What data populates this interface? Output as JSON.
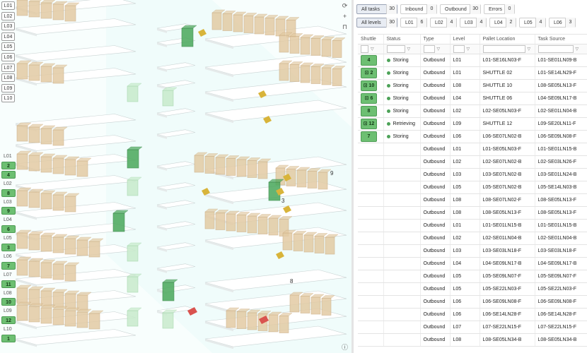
{
  "levels": [
    "L01",
    "L02",
    "L03",
    "L04",
    "L05",
    "L06",
    "L07",
    "L08",
    "L09",
    "L10"
  ],
  "side_list": [
    {
      "kind": "label",
      "text": "L01"
    },
    {
      "kind": "shuttle",
      "text": "2"
    },
    {
      "kind": "shuttle",
      "text": "4"
    },
    {
      "kind": "label",
      "text": "L02"
    },
    {
      "kind": "shuttle",
      "text": "8"
    },
    {
      "kind": "label",
      "text": "L03"
    },
    {
      "kind": "shuttle",
      "text": "9"
    },
    {
      "kind": "label",
      "text": "L04"
    },
    {
      "kind": "shuttle",
      "text": "6"
    },
    {
      "kind": "label",
      "text": "L05"
    },
    {
      "kind": "shuttle",
      "text": "3"
    },
    {
      "kind": "label",
      "text": "L06"
    },
    {
      "kind": "shuttle",
      "text": "7"
    },
    {
      "kind": "label",
      "text": "L07"
    },
    {
      "kind": "shuttle",
      "text": "11"
    },
    {
      "kind": "label",
      "text": "L08"
    },
    {
      "kind": "shuttle",
      "text": "10"
    },
    {
      "kind": "label",
      "text": "L09"
    },
    {
      "kind": "shuttle",
      "text": "12"
    },
    {
      "kind": "label",
      "text": "L10"
    },
    {
      "kind": "shuttle",
      "text": "1"
    }
  ],
  "scene_labels": [
    "9",
    "3",
    "8"
  ],
  "view_tools": [
    "refresh-icon",
    "crosshair-icon",
    "lock-icon"
  ],
  "view_tool_glyphs": {
    "refresh": "⟳",
    "crosshair": "+",
    "lock": "⊓",
    "info": "ⓘ"
  },
  "type_filters": [
    {
      "label": "All tasks",
      "count": "30",
      "active": true
    },
    {
      "label": "Inbound",
      "count": "0",
      "active": false
    },
    {
      "label": "Outbound",
      "count": "30",
      "active": false
    },
    {
      "label": "Errors",
      "count": "0",
      "active": false
    }
  ],
  "level_filters": [
    {
      "label": "All levels",
      "count": "30",
      "active": true
    },
    {
      "label": "L01",
      "count": "6",
      "active": false
    },
    {
      "label": "L02",
      "count": "4",
      "active": false
    },
    {
      "label": "L03",
      "count": "4",
      "active": false
    },
    {
      "label": "L04",
      "count": "2",
      "active": false
    },
    {
      "label": "L05",
      "count": "4",
      "active": false
    },
    {
      "label": "L06",
      "count": "3",
      "active": false
    }
  ],
  "table": {
    "headers": [
      "Shuttle",
      "Status",
      "Type",
      "Level",
      "Pallet Location",
      "Task Source"
    ],
    "rows": [
      {
        "shuttle": "4",
        "icon": false,
        "status": "Storing",
        "type": "Outbound",
        "level": "L01",
        "loc": "L01-SE16LN03-F",
        "src": "L01-SE01LN09-B"
      },
      {
        "shuttle": "2",
        "icon": true,
        "status": "Storing",
        "type": "Outbound",
        "level": "L01",
        "loc": "SHUTTLE 02",
        "src": "L01-SE14LN29-F"
      },
      {
        "shuttle": "10",
        "icon": true,
        "status": "Storing",
        "type": "Outbound",
        "level": "L08",
        "loc": "SHUTTLE 10",
        "src": "L08-SE05LN13-F"
      },
      {
        "shuttle": "6",
        "icon": true,
        "status": "Storing",
        "type": "Outbound",
        "level": "L04",
        "loc": "SHUTTLE 06",
        "src": "L04-SE09LN17-B"
      },
      {
        "shuttle": "8",
        "icon": false,
        "status": "Storing",
        "type": "Outbound",
        "level": "L02",
        "loc": "L02-SE05LN03-F",
        "src": "L02-SE01LN04-B"
      },
      {
        "shuttle": "12",
        "icon": true,
        "status": "Retrieving",
        "type": "Outbound",
        "level": "L09",
        "loc": "SHUTTLE 12",
        "src": "L09-SE20LN11-F"
      },
      {
        "shuttle": "7",
        "icon": false,
        "status": "Storing",
        "type": "Outbound",
        "level": "L06",
        "loc": "L06-SE07LN02-B",
        "src": "L06-SE09LN08-F"
      },
      {
        "shuttle": "",
        "icon": false,
        "status": "",
        "type": "Outbound",
        "level": "L01",
        "loc": "L01-SE05LN03-F",
        "src": "L01-SE01LN15-B"
      },
      {
        "shuttle": "",
        "icon": false,
        "status": "",
        "type": "Outbound",
        "level": "L02",
        "loc": "L02-SE07LN02-B",
        "src": "L02-SE03LN26-F"
      },
      {
        "shuttle": "",
        "icon": false,
        "status": "",
        "type": "Outbound",
        "level": "L03",
        "loc": "L03-SE07LN02-B",
        "src": "L03-SE01LN24-B"
      },
      {
        "shuttle": "",
        "icon": false,
        "status": "",
        "type": "Outbound",
        "level": "L05",
        "loc": "L05-SE07LN02-B",
        "src": "L05-SE14LN03-B"
      },
      {
        "shuttle": "",
        "icon": false,
        "status": "",
        "type": "Outbound",
        "level": "L08",
        "loc": "L08-SE07LN02-F",
        "src": "L08-SE05LN13-F"
      },
      {
        "shuttle": "",
        "icon": false,
        "status": "",
        "type": "Outbound",
        "level": "L08",
        "loc": "L08-SE05LN13-F",
        "src": "L08-SE05LN13-F"
      },
      {
        "shuttle": "",
        "icon": false,
        "status": "",
        "type": "Outbound",
        "level": "L01",
        "loc": "L01-SE01LN15-B",
        "src": "L01-SE01LN15-B"
      },
      {
        "shuttle": "",
        "icon": false,
        "status": "",
        "type": "Outbound",
        "level": "L02",
        "loc": "L02-SE01LN04-B",
        "src": "L02-SE01LN04-B"
      },
      {
        "shuttle": "",
        "icon": false,
        "status": "",
        "type": "Outbound",
        "level": "L03",
        "loc": "L03-SE03LN18-F",
        "src": "L03-SE03LN18-F"
      },
      {
        "shuttle": "",
        "icon": false,
        "status": "",
        "type": "Outbound",
        "level": "L04",
        "loc": "L04-SE09LN17-B",
        "src": "L04-SE09LN17-B"
      },
      {
        "shuttle": "",
        "icon": false,
        "status": "",
        "type": "Outbound",
        "level": "L05",
        "loc": "L05-SE09LN07-F",
        "src": "L05-SE09LN07-F"
      },
      {
        "shuttle": "",
        "icon": false,
        "status": "",
        "type": "Outbound",
        "level": "L05",
        "loc": "L05-SE22LN03-F",
        "src": "L05-SE22LN03-F"
      },
      {
        "shuttle": "",
        "icon": false,
        "status": "",
        "type": "Outbound",
        "level": "L06",
        "loc": "L06-SE09LN08-F",
        "src": "L06-SE09LN08-F"
      },
      {
        "shuttle": "",
        "icon": false,
        "status": "",
        "type": "Outbound",
        "level": "L06",
        "loc": "L06-SE14LN28-F",
        "src": "L06-SE14LN28-F"
      },
      {
        "shuttle": "",
        "icon": false,
        "status": "",
        "type": "Outbound",
        "level": "L07",
        "loc": "L07-SE22LN15-F",
        "src": "L07-SE22LN15-F"
      },
      {
        "shuttle": "",
        "icon": false,
        "status": "",
        "type": "Outbound",
        "level": "L08",
        "loc": "L08-SE05LN34-B",
        "src": "L08-SE05LN34-B"
      }
    ]
  },
  "colors": {
    "shuttle_green": "#6dbf72",
    "pallet_tan": "#e3cba4",
    "active_shuttle": "#4aa85b",
    "floor": "#eefbfa",
    "marker_yellow": "#d8b43a",
    "marker_red": "#d9534f"
  }
}
